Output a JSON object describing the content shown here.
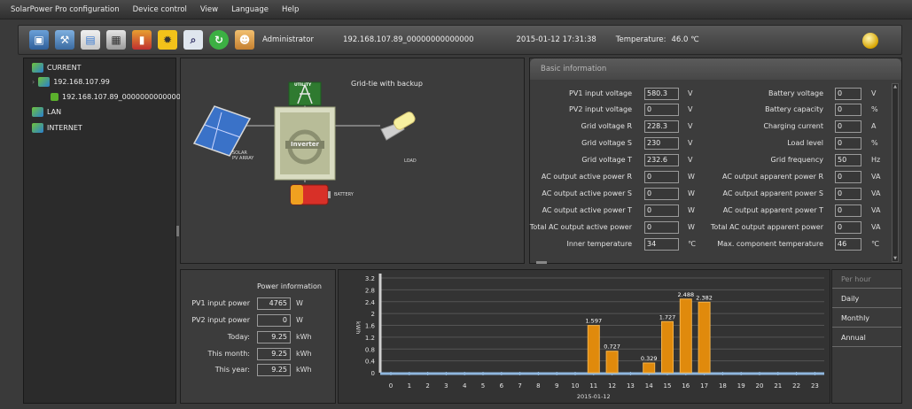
{
  "menu": [
    "SolarPower Pro configuration",
    "Device control",
    "View",
    "Language",
    "Help"
  ],
  "toolbar": {
    "icons": [
      "monitor-icon",
      "device-settings-icon",
      "data-log-icon",
      "data-export-icon",
      "report-icon",
      "alarm-icon",
      "search-icon",
      "refresh-icon",
      "user-icon"
    ],
    "user": "Administrator",
    "device": "192.168.107.89_00000000000000",
    "datetime": "2015-01-12 17:31:38",
    "temperature_label": "Temperature:",
    "temperature_value": "46.0 ℃"
  },
  "tree": {
    "current": "CURRENT",
    "host": "192.168.107.99",
    "device": "192.168.107.89_00000000000000",
    "lan": "LAN",
    "internet": "INTERNET"
  },
  "diagram": {
    "title": "Grid-tie with backup",
    "utility": "UTILITY",
    "inverter": "Inverter",
    "solar": "SOLAR\nPV ARRAY",
    "load": "LOAD",
    "battery": "BATTERY"
  },
  "basic": {
    "title": "Basic information",
    "left": [
      {
        "label": "PV1 input voltage",
        "value": "580.3",
        "unit": "V"
      },
      {
        "label": "PV2 input voltage",
        "value": "0",
        "unit": "V"
      },
      {
        "label": "Grid voltage R",
        "value": "228.3",
        "unit": "V"
      },
      {
        "label": "Grid voltage S",
        "value": "230",
        "unit": "V"
      },
      {
        "label": "Grid voltage T",
        "value": "232.6",
        "unit": "V"
      },
      {
        "label": "AC output active power R",
        "value": "0",
        "unit": "W"
      },
      {
        "label": "AC output active power S",
        "value": "0",
        "unit": "W"
      },
      {
        "label": "AC output active power T",
        "value": "0",
        "unit": "W"
      },
      {
        "label": "Total AC output active power",
        "value": "0",
        "unit": "W"
      },
      {
        "label": "Inner temperature",
        "value": "34",
        "unit": "℃"
      }
    ],
    "right": [
      {
        "label": "Battery voltage",
        "value": "0",
        "unit": "V"
      },
      {
        "label": "Battery capacity",
        "value": "0",
        "unit": "%"
      },
      {
        "label": "Charging current",
        "value": "0",
        "unit": "A"
      },
      {
        "label": "Load level",
        "value": "0",
        "unit": "%"
      },
      {
        "label": "Grid frequency",
        "value": "50",
        "unit": "Hz"
      },
      {
        "label": "AC output apparent power R",
        "value": "0",
        "unit": "VA"
      },
      {
        "label": "AC output apparent power S",
        "value": "0",
        "unit": "VA"
      },
      {
        "label": "AC output apparent power T",
        "value": "0",
        "unit": "VA"
      },
      {
        "label": "Total AC output apparent power",
        "value": "0",
        "unit": "VA"
      },
      {
        "label": "Max. component temperature",
        "value": "46",
        "unit": "℃"
      }
    ]
  },
  "power": {
    "title": "Power information",
    "rows": [
      {
        "label": "PV1 input power",
        "value": "4765",
        "unit": "W"
      },
      {
        "label": "PV2 input power",
        "value": "0",
        "unit": "W"
      },
      {
        "label": "Today:",
        "value": "9.25",
        "unit": "kWh"
      },
      {
        "label": "This month:",
        "value": "9.25",
        "unit": "kWh"
      },
      {
        "label": "This year:",
        "value": "9.25",
        "unit": "kWh"
      }
    ]
  },
  "periods": [
    "Per hour",
    "Daily",
    "Monthly",
    "Annual"
  ],
  "chart_data": {
    "type": "bar",
    "ylabel": "kWh",
    "xlabel": "2015-01-12",
    "ylim": [
      0,
      3.2
    ],
    "yticks": [
      "0",
      "0.4",
      "0.8",
      "1.2",
      "1.6",
      "2",
      "2.4",
      "2.8",
      "3.2"
    ],
    "categories": [
      "0",
      "1",
      "2",
      "3",
      "4",
      "5",
      "6",
      "7",
      "8",
      "9",
      "10",
      "11",
      "12",
      "13",
      "14",
      "15",
      "16",
      "17",
      "18",
      "19",
      "20",
      "21",
      "22",
      "23"
    ],
    "values": [
      0,
      0,
      0,
      0,
      0,
      0,
      0,
      0,
      0,
      0,
      0,
      1.597,
      0.727,
      0,
      0.329,
      1.727,
      2.488,
      2.382,
      0,
      0,
      0,
      0,
      0,
      0
    ],
    "labels": [
      "",
      "",
      "",
      "",
      "",
      "",
      "",
      "",
      "",
      "",
      "",
      "1.597",
      "0.727",
      "",
      "0.329",
      "1.727",
      "2.488",
      "2.382",
      "",
      "",
      "",
      "",
      "",
      ""
    ],
    "bar_color": "#e08a0c",
    "grid": true
  }
}
